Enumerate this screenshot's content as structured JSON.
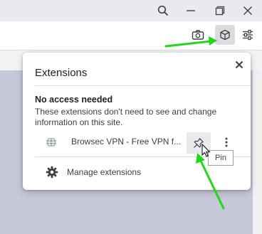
{
  "popup": {
    "title": "Extensions",
    "section_heading": "No access needed",
    "section_description": "These extensions don't need to see and change information on this site.",
    "extension_name": "Browsec VPN - Free VPN f...",
    "manage_label": "Manage extensions"
  },
  "tooltip": {
    "text": "Pin"
  },
  "colors": {
    "annotation_arrow": "#22d61a",
    "page_background": "#c5c8d8",
    "active_button": "#dadce0"
  }
}
